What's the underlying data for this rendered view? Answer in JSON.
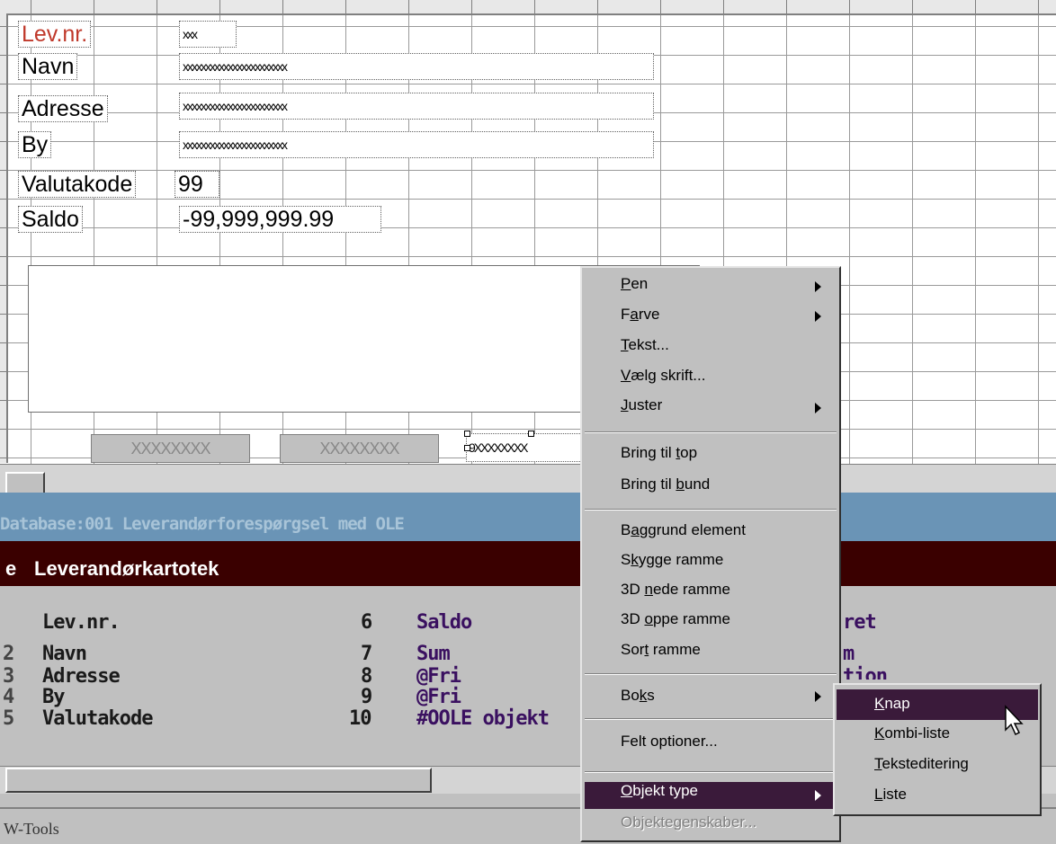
{
  "form": {
    "labels": [
      "Lev.nr.",
      "Navn",
      "Adresse",
      "By",
      "Valutakode",
      "Saldo"
    ],
    "values": [
      "xxx",
      "xxxxxxxxxxxxxxxxxxxxxxx",
      "xxxxxxxxxxxxxxxxxxxxxxx",
      "xxxxxxxxxxxxxxxxxxxxxxx",
      "99",
      "-99,999,999.99"
    ],
    "buttons": [
      "XXXXXXXX",
      "XXXXXXXX"
    ],
    "selected_field": "9XXXXXXXX"
  },
  "database": {
    "title": "Database:001  Leverandørforespørgsel med OLE",
    "table_prefix": "e",
    "table_name": "Leverandørkartotek",
    "col1_edge": [
      "",
      "2",
      "3",
      "4",
      "5"
    ],
    "col1": [
      "Lev.nr.",
      "Navn",
      "Adresse",
      "By",
      "Valutakode"
    ],
    "col2_num": [
      "6",
      "7",
      "8",
      "9",
      "10"
    ],
    "col2": [
      "Saldo",
      "Sum",
      "@Fri",
      "@Fri",
      "#OOLE objekt"
    ],
    "col3": [
      "ret",
      "m",
      "tion"
    ]
  },
  "statusbar": {
    "text": "W-Tools"
  },
  "context_menu": {
    "items": [
      {
        "pre": "",
        "u": "P",
        "post": "en"
      },
      {
        "pre": "F",
        "u": "a",
        "post": "rve"
      },
      {
        "pre": "",
        "u": "T",
        "post": "ekst..."
      },
      {
        "pre": "",
        "u": "V",
        "post": "ælg skrift..."
      },
      {
        "pre": "",
        "u": "J",
        "post": "uster"
      },
      {
        "pre": "Bring til ",
        "u": "t",
        "post": "op"
      },
      {
        "pre": "Bring til ",
        "u": "b",
        "post": "und"
      },
      {
        "pre": "B",
        "u": "a",
        "post": "ggrund element"
      },
      {
        "pre": "S",
        "u": "k",
        "post": "ygge ramme"
      },
      {
        "pre": "3D ",
        "u": "n",
        "post": "ede ramme"
      },
      {
        "pre": "3D ",
        "u": "o",
        "post": "ppe ramme"
      },
      {
        "pre": "Sor",
        "u": "t",
        "post": " ramme"
      },
      {
        "pre": "Bo",
        "u": "k",
        "post": "s"
      },
      {
        "pre": "Felt optioner...",
        "u": "",
        "post": ""
      },
      {
        "pre": "",
        "u": "O",
        "post": "bjekt type"
      },
      {
        "pre": "Objektegenskaber...",
        "u": "",
        "post": ""
      }
    ]
  },
  "submenu": {
    "items": [
      {
        "u": "K",
        "post": "nap"
      },
      {
        "u": "K",
        "post": "ombi-liste"
      },
      {
        "u": "T",
        "post": "eksteditering"
      },
      {
        "u": "L",
        "post": "iste"
      }
    ]
  },
  "colors": {
    "menu_highlight": "#3a1a3a",
    "db_titlebar": "#6a94b6",
    "table_bar": "#3a0000"
  }
}
